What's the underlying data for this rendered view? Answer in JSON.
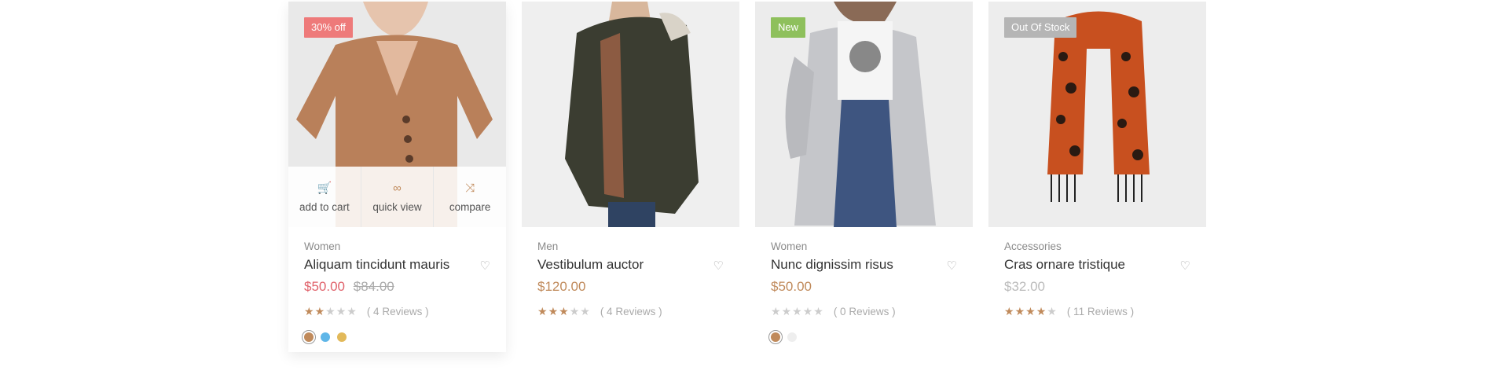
{
  "colors": {
    "accent": "#c08a5b",
    "sale_price": "#e0626b",
    "badge_sale": "#ee7a7a",
    "badge_new": "#8ec05c",
    "badge_oos": "#b5b5b5"
  },
  "actions": {
    "add_to_cart": "add to cart",
    "quick_view": "quick view",
    "compare": "compare"
  },
  "products": [
    {
      "badge": "30% off",
      "category": "Women",
      "name": "Aliquam tincidunt mauris",
      "price": "$50.00",
      "old_price": "$84.00",
      "rating": 2,
      "reviews": "( 4 Reviews )",
      "swatches": [
        "#c08a5b",
        "#5fb6e8",
        "#e2b95a"
      ]
    },
    {
      "badge": "",
      "category": "Men",
      "name": "Vestibulum auctor",
      "price": "$120.00",
      "old_price": "",
      "rating": 3,
      "reviews": "( 4 Reviews )",
      "swatches": []
    },
    {
      "badge": "New",
      "category": "Women",
      "name": "Nunc dignissim risus",
      "price": "$50.00",
      "old_price": "",
      "rating": 0,
      "reviews": "( 0 Reviews )",
      "swatches": [
        "#c08a5b",
        "#eeeeee"
      ]
    },
    {
      "badge": "Out Of Stock",
      "category": "Accessories",
      "name": "Cras ornare tristique",
      "price": "$32.00",
      "old_price": "",
      "rating": 4,
      "reviews": "( 11 Reviews )",
      "swatches": []
    }
  ]
}
